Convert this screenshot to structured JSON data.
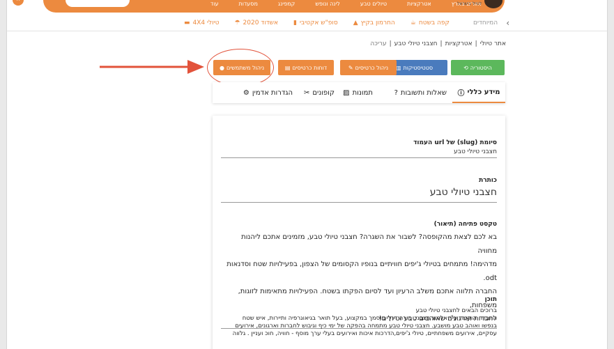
{
  "header": {
    "nav_items": [
      "אזורים בארץ",
      "אטרקציות",
      "טיולים טבע",
      "לינה ונופש",
      "קמפינג",
      "מסעדות",
      "עוד"
    ],
    "logo_text": "לטייל בישראל"
  },
  "subnav": {
    "muted": "המיוחדים",
    "items": [
      {
        "label": "קפה בשטח",
        "icon": "coffee-icon"
      },
      {
        "label": "החרמון בקיץ",
        "icon": "mountain-icon"
      },
      {
        "label": "סופ\"ש אקטיבי",
        "icon": "chart-icon"
      },
      {
        "label": "אשדוד 2020",
        "icon": "umbrella-icon"
      },
      {
        "label": "טיולי 4X4",
        "icon": "car-icon"
      }
    ]
  },
  "breadcrumb": [
    "אתר טיולי",
    "אטרקציות",
    "חצבני טיולי טבע",
    "עריכה"
  ],
  "actions": {
    "history": "היסטוריה",
    "stats": "סטטיסטיקות",
    "cards": "ניהול כרטיסים",
    "reports": "דוחות כרטיסים",
    "users": "ניהול משתמשים"
  },
  "tabs": {
    "general": "מידע כללי",
    "faq": "שאלות ותשובות",
    "images": "תמונות",
    "coupons": "קופונים",
    "admin": "הגדרות אדמין"
  },
  "form": {
    "slug_label": "סיומת (slug) של url העמוד",
    "slug_value": "חצבני טיולי טבע",
    "title_label": "כותרת",
    "title_value": "חצבני טיולי טבע",
    "intro_label": "טקסט פתיחה (תיאור)",
    "intro_lines": [
      "בא לכם לצאת מהקופסה? לשבור את השגרה? חצבני טיולי טבע, מזמינים אתכם ליהנות מחוויה",
      "מדהימה! מתמחים בטיולי ג'יפים חוויתיים בנופיו הקסומים של הצפון, בפעילויות שטח וסדנאות odt.",
      "החברה תלווה אתכם משלב הרעיון ועד לסיום הפקתו בשטח. הפעילויות מתאימות לזוגות, משפחות,",
      "לחברות וארגונים שאוהבים טבע וטיולים!"
    ],
    "content_label": "תוכן",
    "content_lines": [
      "ברוכים הבאים לחצבני טיולי טבע",
      "החברה הוקמה ע\"י אלמוג חצבני, מורה דרך מוסמך במקצוע, בעל תואר בגיאוגרפיה ותיירות, איש שטח",
      "בנפשו ואוהב טבע מושבע. חצבני טיולי טבע מתמחה בהפקה של ימי כיף וגיבוש לחברות וארגונים, אירועים",
      "עסקיים, אירועים משפחתיים, טיולי ג'יפים,הדרכות איכות ואירועים בעלי ערך מוסף - חוויה, חוכ ועניין . גלווה"
    ]
  },
  "colors": {
    "brand_orange": "#ec8a3f",
    "green": "#5cb85c",
    "blue": "#4a7bbd",
    "annotation_red": "#e2533b"
  }
}
